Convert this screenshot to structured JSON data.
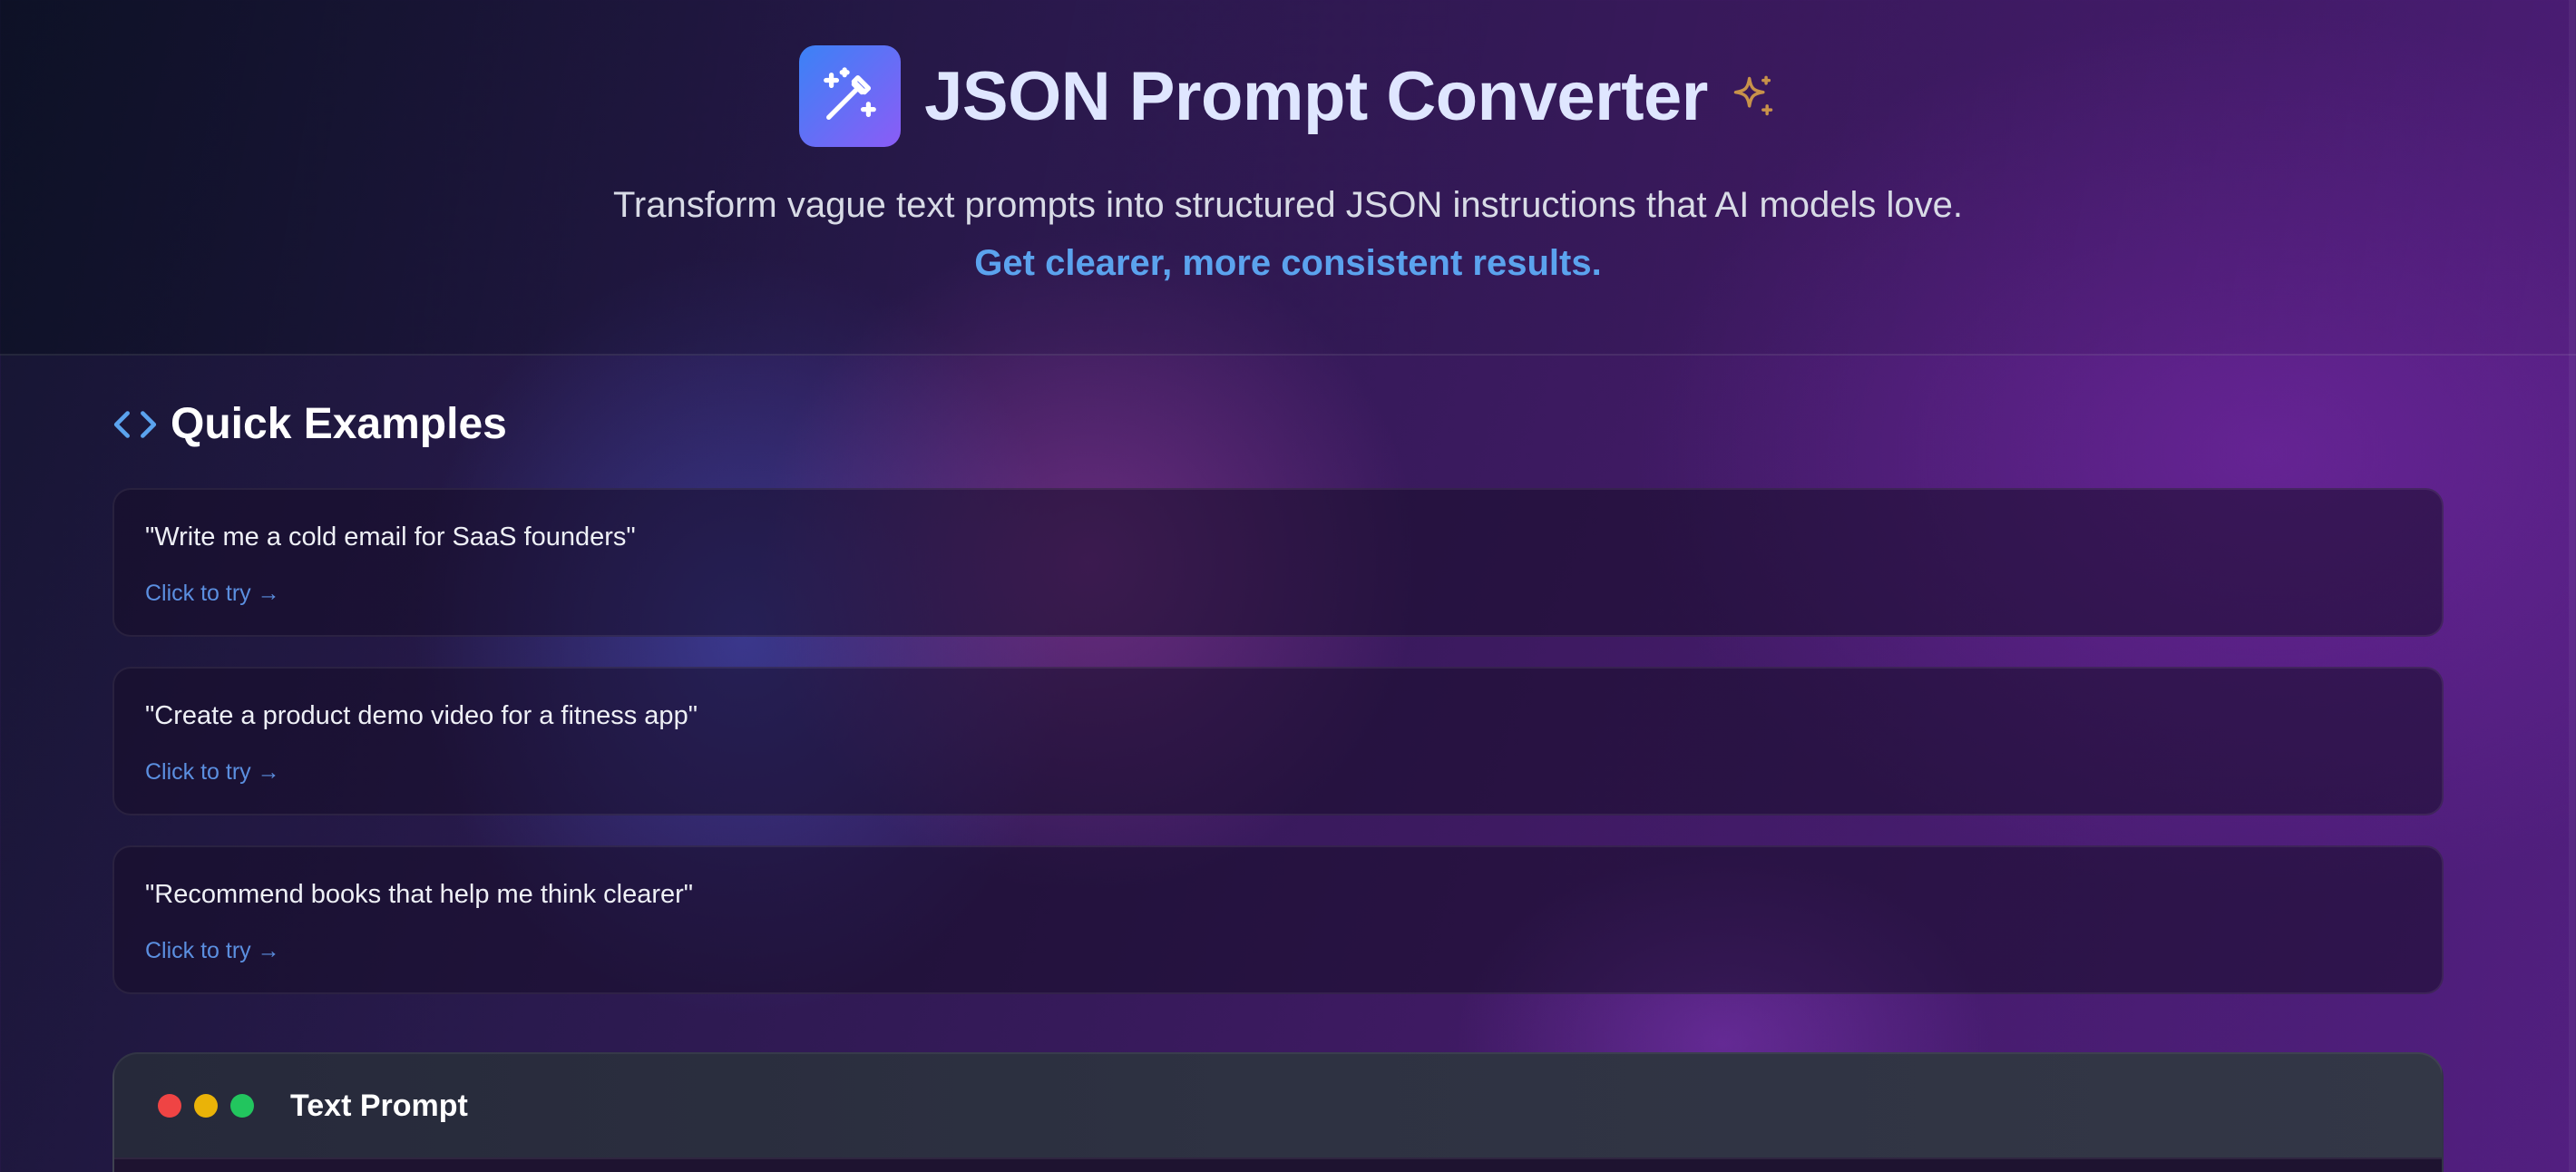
{
  "header": {
    "title": "JSON Prompt Converter",
    "logo_icon": "magic-wand-icon",
    "title_icon": "sparkles-icon",
    "subtitle": "Transform vague text prompts into structured JSON instructions that AI models love.",
    "subtitle_accent": "Get clearer, more consistent results."
  },
  "examples": {
    "heading": "Quick Examples",
    "heading_icon": "code-icon",
    "items": [
      {
        "prompt": "\"Write me a cold email for SaaS founders\"",
        "action": "Click to try →"
      },
      {
        "prompt": "\"Create a product demo video for a fitness app\"",
        "action": "Click to try →"
      },
      {
        "prompt": "\"Recommend books that help me think clearer\"",
        "action": "Click to try →"
      }
    ]
  },
  "text_panel": {
    "title": "Text Prompt"
  },
  "colors": {
    "accent_blue": "#5ba3ee",
    "logo_gradient_start": "#3b82f6",
    "logo_gradient_end": "#8b5cf6",
    "sparkle": "#c8924a",
    "dot_red": "#ef4444",
    "dot_yellow": "#eab308",
    "dot_green": "#22c55e"
  }
}
